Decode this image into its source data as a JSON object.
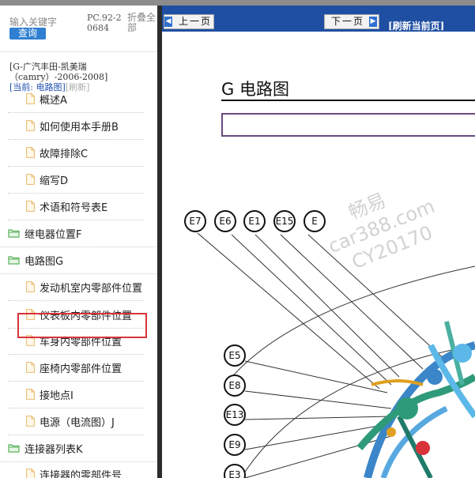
{
  "sidebar": {
    "search_placeholder": "输入关键字",
    "search_button": "查询",
    "pc_code": "PC.92-20684",
    "collapse_all": "折叠全部",
    "model_line1": "[G-广汽丰田-凯美瑞",
    "model_line2": "（camry）-2006-2008]",
    "current_prefix": "[当前: 电路图]",
    "refresh_label": "[刷新]",
    "items": [
      {
        "label": "概述A",
        "type": "doc"
      },
      {
        "label": "如何使用本手册B",
        "type": "doc"
      },
      {
        "label": "故障排除C",
        "type": "doc"
      },
      {
        "label": "缩写D",
        "type": "doc"
      },
      {
        "label": "术语和符号表E",
        "type": "doc"
      },
      {
        "label": "继电器位置F",
        "type": "folder"
      },
      {
        "label": "电路图G",
        "type": "folder-open"
      },
      {
        "label": "发动机室内零部件位置",
        "type": "doc"
      },
      {
        "label": "仪表板内零部件位置",
        "type": "doc",
        "highlighted": true
      },
      {
        "label": "车身内零部件位置",
        "type": "doc"
      },
      {
        "label": "座椅内零部件位置",
        "type": "doc"
      },
      {
        "label": "接地点I",
        "type": "doc"
      },
      {
        "label": "电源（电流图）J",
        "type": "doc"
      },
      {
        "label": "连接器列表K",
        "type": "folder-open"
      },
      {
        "label": "连接器的零部件号",
        "type": "doc"
      }
    ]
  },
  "toolbar": {
    "prev_label": "上一页",
    "next_label": "下一页",
    "refresh_label": "[刷新当前页]"
  },
  "content": {
    "title": "G 电路图",
    "connectors_top": [
      "E7",
      "E6",
      "E1",
      "E15",
      "E"
    ],
    "connectors_left": [
      "E5",
      "E8",
      "E13",
      "E9",
      "E3"
    ],
    "watermark_1": "畅易",
    "watermark_2": "car388.com",
    "watermark_3": "CY20170"
  },
  "colors": {
    "toolbar": "#1e4fa3",
    "search_button": "#2f7fd2",
    "highlight_border": "#d9333a",
    "folder": "#5bb05b",
    "doc_icon": "#e8b96a"
  }
}
